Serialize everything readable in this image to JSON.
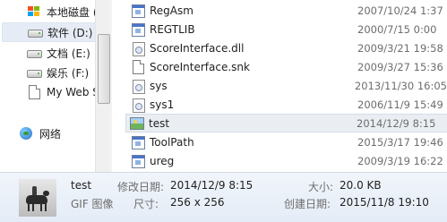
{
  "navigation": {
    "items": [
      {
        "label": "本地磁盘 (C:)",
        "icon": "windows-drive-icon"
      },
      {
        "label": "软件 (D:)",
        "icon": "drive-icon",
        "selected": true
      },
      {
        "label": "文档 (E:)",
        "icon": "drive-icon"
      },
      {
        "label": "娱乐 (F:)",
        "icon": "drive-icon"
      },
      {
        "label": "My Web S",
        "icon": "document-icon"
      },
      {
        "label": "网络",
        "icon": "network-icon"
      }
    ]
  },
  "files": [
    {
      "name": "RegAsm",
      "modified": "2007/10/24 1:37",
      "icon": "exe-icon"
    },
    {
      "name": "REGTLIB",
      "modified": "2000/7/15 0:00",
      "icon": "exe-icon"
    },
    {
      "name": "ScoreInterface.dll",
      "modified": "2009/3/21 19:58",
      "icon": "dll-icon"
    },
    {
      "name": "ScoreInterface.snk",
      "modified": "2009/3/27 15:36",
      "icon": "file-icon"
    },
    {
      "name": "sys",
      "modified": "2013/11/30 16:05",
      "icon": "config-icon"
    },
    {
      "name": "sys1",
      "modified": "2006/11/9 15:49",
      "icon": "config-icon"
    },
    {
      "name": "test",
      "modified": "2014/12/9 8:15",
      "icon": "gif-image-icon",
      "selected": true
    },
    {
      "name": "ToolPath",
      "modified": "2015/3/17 19:46",
      "icon": "exe-icon"
    },
    {
      "name": "ureg",
      "modified": "2009/3/19 16:22",
      "icon": "exe-icon"
    }
  ],
  "details": {
    "name": "test",
    "type": "GIF 图像",
    "modified_label": "修改日期:",
    "modified_value": "2014/12/9 8:15",
    "dimensions_label": "尺寸:",
    "dimensions_value": "256 x 256",
    "size_label": "大小:",
    "size_value": "20.0 KB",
    "created_label": "创建日期:",
    "created_value": "2015/11/8 19:10"
  },
  "colors": {
    "selection_bg": "#eaeef3",
    "status_bg": "#e4ecf7",
    "date_text": "#6d6d6d"
  }
}
